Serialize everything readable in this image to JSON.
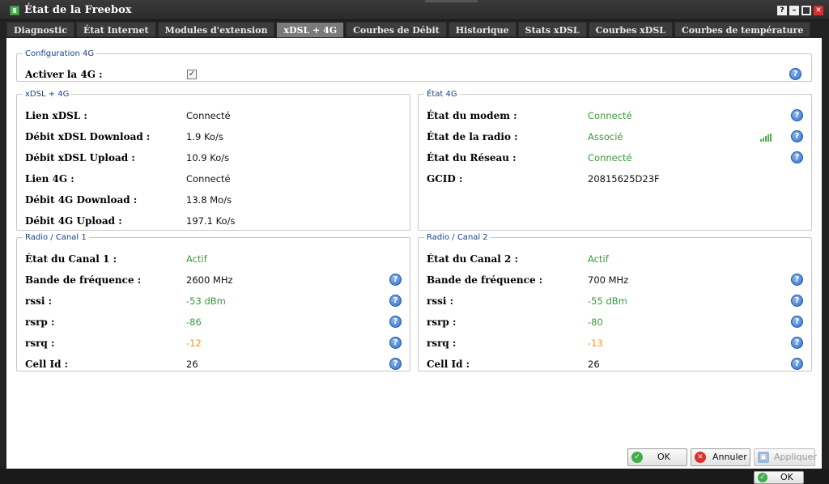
{
  "window": {
    "title": "État de la Freebox"
  },
  "tabs": [
    {
      "label": "Diagnostic"
    },
    {
      "label": "État Internet"
    },
    {
      "label": "Modules d'extension"
    },
    {
      "label": "xDSL + 4G"
    },
    {
      "label": "Courbes de Débit"
    },
    {
      "label": "Historique"
    },
    {
      "label": "Stats xDSL"
    },
    {
      "label": "Courbes xDSL"
    },
    {
      "label": "Courbes de température"
    }
  ],
  "config": {
    "legend": "Configuration 4G",
    "activate_label": "Activer la 4G :",
    "activate_checked": true
  },
  "xdsl": {
    "legend": "xDSL + 4G",
    "rows": [
      {
        "label": "Lien xDSL :",
        "value": "Connecté"
      },
      {
        "label": "Débit xDSL Download :",
        "value": "1.9 Ko/s"
      },
      {
        "label": "Débit xDSL Upload :",
        "value": "10.9 Ko/s"
      },
      {
        "label": "Lien 4G :",
        "value": "Connecté"
      },
      {
        "label": "Débit 4G Download :",
        "value": "13.8 Mo/s"
      },
      {
        "label": "Débit 4G Upload :",
        "value": "197.1 Ko/s"
      }
    ]
  },
  "etat4g": {
    "legend": "État 4G",
    "rows": [
      {
        "label": "État du modem :",
        "value": "Connecté",
        "color": "#3a9a3a"
      },
      {
        "label": "État de la radio :",
        "value": "Associé",
        "color": "#3a9a3a",
        "signal_icon": "signal-bars-icon"
      },
      {
        "label": "État du Réseau :",
        "value": "Connecté",
        "color": "#3a9a3a"
      },
      {
        "label": "GCID :",
        "value": "20815625D23F"
      }
    ]
  },
  "canal1": {
    "legend": "Radio / Canal 1",
    "rows": [
      {
        "label": "État du Canal 1 :",
        "value": "Actif",
        "color": "#3a9a3a"
      },
      {
        "label": "Bande de fréquence :",
        "value": "2600 MHz"
      },
      {
        "label": "rssi :",
        "value": "-53 dBm",
        "color": "#3a9a3a"
      },
      {
        "label": "rsrp :",
        "value": "-86",
        "color": "#3a9a3a"
      },
      {
        "label": "rsrq :",
        "value": "-12",
        "color": "#f0941c"
      },
      {
        "label": "Cell Id :",
        "value": "26"
      }
    ]
  },
  "canal2": {
    "legend": "Radio / Canal 2",
    "rows": [
      {
        "label": "État du Canal 2 :",
        "value": "Actif",
        "color": "#3a9a3a"
      },
      {
        "label": "Bande de fréquence :",
        "value": "700 MHz"
      },
      {
        "label": "rssi :",
        "value": "-55 dBm",
        "color": "#3a9a3a"
      },
      {
        "label": "rsrp :",
        "value": "-80",
        "color": "#3a9a3a"
      },
      {
        "label": "rsrq :",
        "value": "-13",
        "color": "#f0941c"
      },
      {
        "label": "Cell Id :",
        "value": "26"
      }
    ]
  },
  "buttons": {
    "ok": "OK",
    "cancel": "Annuler",
    "apply": "Appliquer",
    "ok_outer": "OK"
  }
}
